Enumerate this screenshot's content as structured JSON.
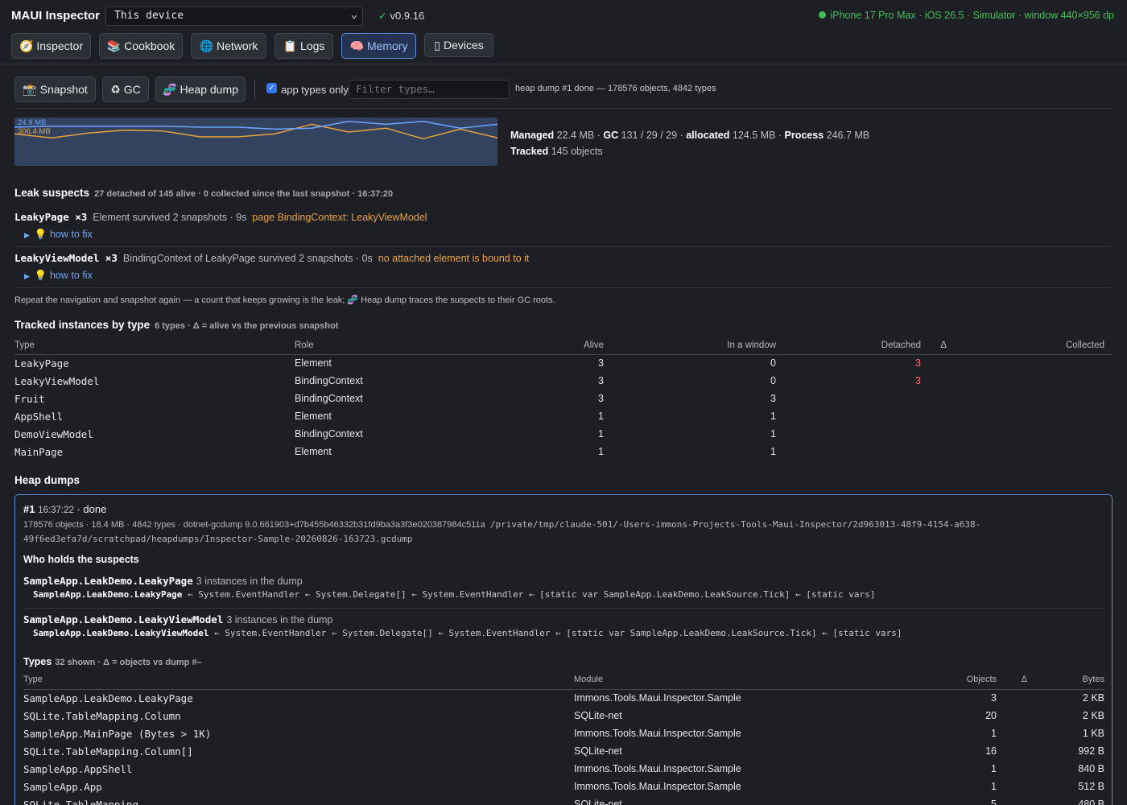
{
  "header": {
    "app_title": "MAUI Inspector",
    "device_select": "This device",
    "version_check": "✓",
    "version": "v0.9.16",
    "device_info": "iPhone 17 Pro Max · iOS 26.5 · Simulator · window 440×956 dp"
  },
  "tabs": [
    {
      "icon": "🧭",
      "label": "Inspector"
    },
    {
      "icon": "📚",
      "label": "Cookbook"
    },
    {
      "icon": "🌐",
      "label": "Network"
    },
    {
      "icon": "📋",
      "label": "Logs"
    },
    {
      "icon": "🧠",
      "label": "Memory"
    },
    {
      "icon": "▯",
      "label": "Devices"
    }
  ],
  "active_tab": "Memory",
  "toolbar": {
    "snapshot_icon": "📸",
    "snapshot_label": "Snapshot",
    "gc_icon": "♻",
    "gc_label": "GC",
    "heapdump_icon": "🧬",
    "heapdump_label": "Heap dump",
    "app_types_only_checked": true,
    "app_types_only_label": "app types only",
    "filter_placeholder": "Filter types…",
    "status": "heap dump #1 done — 178576 objects, 4842 types"
  },
  "sparkline": {
    "label_managed": "24.9 MB",
    "label_process": "306.4 MB",
    "managed_series": [
      0.8,
      0.82,
      0.82,
      0.82,
      0.82,
      0.8,
      0.8,
      0.76,
      0.78,
      0.92,
      0.86,
      0.92,
      0.78,
      0.86
    ],
    "process_series": [
      0.66,
      0.58,
      0.68,
      0.74,
      0.72,
      0.6,
      0.6,
      0.66,
      0.86,
      0.7,
      0.78,
      0.56,
      0.76,
      0.58
    ],
    "managed_color": "#6aa6ff",
    "process_color": "#e8a33d"
  },
  "stats": {
    "managed_label": "Managed",
    "managed_value": "22.4 MB",
    "gc_label": "GC",
    "gc_value": "131 / 29 / 29",
    "allocated_label": "allocated",
    "allocated_value": "124.5 MB",
    "process_label": "Process",
    "process_value": "246.7 MB",
    "tracked_label": "Tracked",
    "tracked_value": "145 objects"
  },
  "leak": {
    "title": "Leak suspects",
    "subtitle": "27 detached of 145 alive · 0 collected since the last snapshot · 16:37:20",
    "suspects": [
      {
        "name": "LeakyPage ×3",
        "detail": "Element  survived 2 snapshots · 9s",
        "warning": "page  BindingContext: LeakyViewModel",
        "howto": "how to fix"
      },
      {
        "name": "LeakyViewModel ×3",
        "detail": "BindingContext  of LeakyPage  survived 2 snapshots · 0s",
        "warning": "no attached element is bound to it",
        "howto": "how to fix"
      }
    ],
    "howto_icon": "💡",
    "hint": "Repeat the navigation and snapshot again — a count that keeps growing is the leak; 🧬 Heap dump traces the suspects to their GC roots."
  },
  "tracked": {
    "title": "Tracked instances by type",
    "subtitle": "6 types · Δ = alive vs the previous snapshot",
    "columns": [
      "Type",
      "Role",
      "Alive",
      "In a window",
      "Detached",
      "Δ",
      "Collected"
    ],
    "rows": [
      {
        "type": "LeakyPage",
        "role": "Element",
        "alive": "3",
        "window": "0",
        "detached": "3",
        "delta": "",
        "collected": ""
      },
      {
        "type": "LeakyViewModel",
        "role": "BindingContext",
        "alive": "3",
        "window": "0",
        "detached": "3",
        "delta": "",
        "collected": ""
      },
      {
        "type": "Fruit",
        "role": "BindingContext",
        "alive": "3",
        "window": "3",
        "detached": "",
        "delta": "",
        "collected": ""
      },
      {
        "type": "AppShell",
        "role": "Element",
        "alive": "1",
        "window": "1",
        "detached": "",
        "delta": "",
        "collected": ""
      },
      {
        "type": "DemoViewModel",
        "role": "BindingContext",
        "alive": "1",
        "window": "1",
        "detached": "",
        "delta": "",
        "collected": ""
      },
      {
        "type": "MainPage",
        "role": "Element",
        "alive": "1",
        "window": "1",
        "detached": "",
        "delta": "",
        "collected": ""
      }
    ]
  },
  "heap": {
    "title": "Heap dumps",
    "dump_id": "#1",
    "dump_time": "16:37:22",
    "dump_state": "· done",
    "meta": "178576 objects · 18.4 MB · 4842 types · dotnet-gcdump 9.0.661903+d7b455b46332b31fd9ba3a3f3e020387984c511a",
    "path": "/private/tmp/claude-501/-Users-immons-Projects-Tools-Maui-Inspector/2d963013-48f9-4154-a638-49f6ed3efa7d/scratchpad/heapdumps/Inspector-Sample-20260826-163723.gcdump",
    "holders_title": "Who holds the suspects",
    "holders": [
      {
        "name": "SampleApp.LeakDemo.LeakyPage",
        "count": "3 instances in the dump",
        "path_head": "SampleApp.LeakDemo.LeakyPage",
        "path_rest": " ← System.EventHandler ← System.Delegate[] ← System.EventHandler ← [static var SampleApp.LeakDemo.LeakSource.Tick] ← [static vars]"
      },
      {
        "name": "SampleApp.LeakDemo.LeakyViewModel",
        "count": "3 instances in the dump",
        "path_head": "SampleApp.LeakDemo.LeakyViewModel",
        "path_rest": " ← System.EventHandler ← System.Delegate[] ← System.EventHandler ← [static var SampleApp.LeakDemo.LeakSource.Tick] ← [static vars]"
      }
    ],
    "types_title": "Types",
    "types_subtitle": "32 shown · Δ = objects vs dump #–",
    "types_columns": [
      "Type",
      "Module",
      "Objects",
      "Δ",
      "Bytes"
    ],
    "types_rows": [
      {
        "type": "SampleApp.LeakDemo.LeakyPage",
        "module": "Immons.Tools.Maui.Inspector.Sample",
        "objects": "3",
        "delta": "",
        "bytes": "2 KB"
      },
      {
        "type": "SQLite.TableMapping.Column",
        "module": "SQLite-net",
        "objects": "20",
        "delta": "",
        "bytes": "2 KB"
      },
      {
        "type": "SampleApp.MainPage (Bytes > 1K)",
        "module": "Immons.Tools.Maui.Inspector.Sample",
        "objects": "1",
        "delta": "",
        "bytes": "1 KB"
      },
      {
        "type": "SQLite.TableMapping.Column[]",
        "module": "SQLite-net",
        "objects": "16",
        "delta": "",
        "bytes": "992 B"
      },
      {
        "type": "SampleApp.AppShell",
        "module": "Immons.Tools.Maui.Inspector.Sample",
        "objects": "1",
        "delta": "",
        "bytes": "840 B"
      },
      {
        "type": "SampleApp.App",
        "module": "Immons.Tools.Maui.Inspector.Sample",
        "objects": "1",
        "delta": "",
        "bytes": "512 B"
      },
      {
        "type": "SQLite.TableMapping",
        "module": "SQLite-net",
        "objects": "5",
        "delta": "",
        "bytes": "480 B"
      }
    ]
  }
}
